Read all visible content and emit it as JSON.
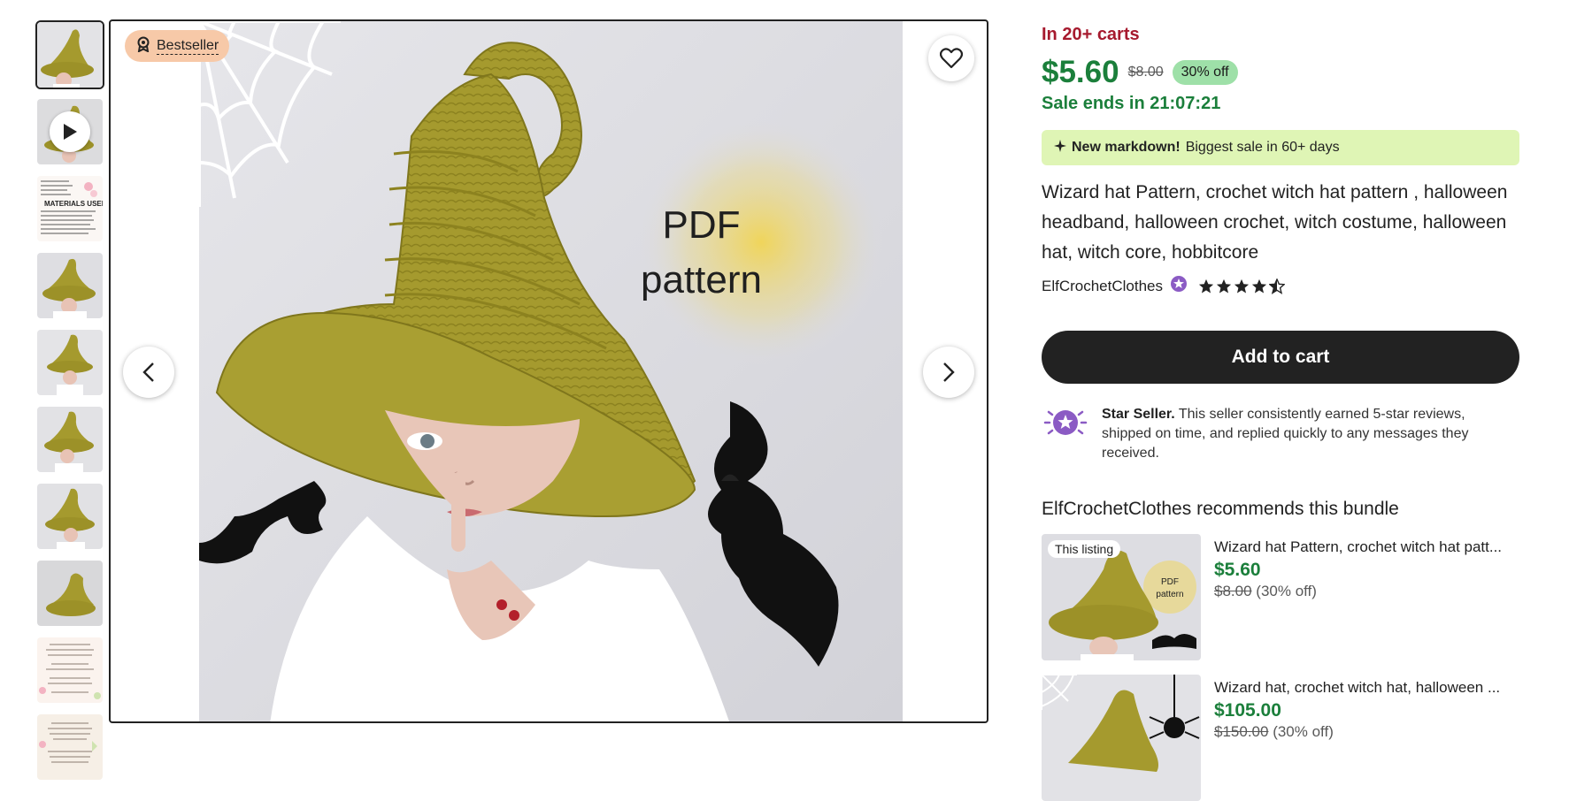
{
  "gallery": {
    "thumbnail_count": 10,
    "bestseller_label": "Bestseller",
    "overlay_text_line1": "PDF",
    "overlay_text_line2": "pattern",
    "thumb3_title": "MATERIALS USED"
  },
  "listing": {
    "carts": "In 20+ carts",
    "price": "$5.60",
    "old_price": "$8.00",
    "discount": "30% off",
    "sale_ends": "Sale ends in 21:07:21",
    "markdown_bold": "New markdown!",
    "markdown_text": "Biggest sale in 60+ days",
    "title": "Wizard hat Pattern, crochet witch hat pattern , halloween headband, halloween crochet, witch costume, halloween hat, witch core, hobbitcore",
    "shop_name": "ElfCrochetClothes",
    "rating": 4.5,
    "add_to_cart": "Add to cart",
    "star_seller_bold": "Star Seller.",
    "star_seller_text": "This seller consistently earned 5-star reviews, shipped on time, and replied quickly to any messages they received."
  },
  "bundle": {
    "title": "ElfCrochetClothes recommends this bundle",
    "items": [
      {
        "tag": "This listing",
        "name": "Wizard hat Pattern, crochet witch hat patt...",
        "price": "$5.60",
        "old_price": "$8.00",
        "discount": "(30% off)",
        "img_text1": "PDF",
        "img_text2": "pattern"
      },
      {
        "name": "Wizard hat, crochet witch hat, halloween ...",
        "price": "$105.00",
        "old_price": "$150.00",
        "discount": "(30% off)"
      }
    ]
  },
  "colors": {
    "sale_green": "#1b7f3b",
    "carts_red": "#a61a2e",
    "hat_olive": "#a59a2e",
    "badge_peach": "#f7c9a8",
    "markdown_bg": "#dff5b5",
    "star_purple": "#8b5bc4"
  }
}
